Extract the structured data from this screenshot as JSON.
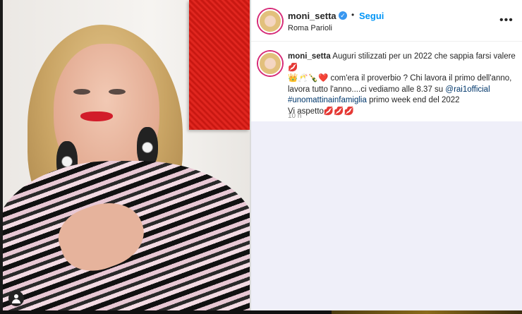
{
  "post": {
    "header": {
      "username": "moni_setta",
      "verified_symbol": "✓",
      "separator": "•",
      "follow_label": "Segui",
      "location": "Roma Parioli",
      "more_label": "•••"
    },
    "caption": {
      "username": "moni_setta",
      "line1": "Auguri stilizzati per un 2022 che sappia farsi valere💋",
      "line2": "👑🥂🍾❤️ com'era il proverbio ? Chi lavora il primo dell'anno,",
      "line3_pre": "lavora tutto l'anno....ci vediamo alle 8.37 su ",
      "line3_mention": "@rai1official",
      "line4_hashtag": "#unomattinainfamiglia",
      "line4_post": " primo week end del 2022",
      "line5": "Vi aspetto💋💋💋"
    },
    "time": "10 h"
  },
  "icons": {
    "verified": "verified-badge-icon",
    "more": "more-options-icon",
    "profile": "profile-avatar-icon",
    "user": "user-tag-icon"
  },
  "colors": {
    "accent_blue": "#0095f6",
    "verified_blue": "#3897f0",
    "mention": "#00376b",
    "muted": "#8e8e8e"
  }
}
